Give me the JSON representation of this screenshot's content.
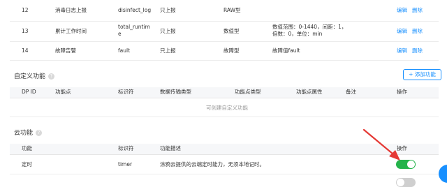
{
  "standard_rows": [
    {
      "id": "12",
      "name": "消毒日志上报",
      "identifier": "disinfect_log",
      "transfer": "只上报",
      "type": "RAW型",
      "attr": "",
      "edit": "编辑",
      "del": "删除"
    },
    {
      "id": "13",
      "name": "累计工作时间",
      "identifier_l1": "total_runtim",
      "identifier_l2": "e",
      "transfer": "只上报",
      "type": "数值型",
      "attr_l1": "数值范围：0-1440，间距：1，",
      "attr_l2": "倍数：0，单位：min",
      "edit": "编辑",
      "del": "删除"
    },
    {
      "id": "14",
      "name": "故障告警",
      "identifier": "fault",
      "transfer": "只上报",
      "type": "故障型",
      "attr": "故障值fault",
      "edit": "编辑",
      "del": "删除"
    }
  ],
  "custom": {
    "title": "自定义功能",
    "add_button": "+ 添加功能",
    "headers": [
      "DP ID",
      "功能点",
      "标识符",
      "数据传输类型",
      "功能点类型",
      "功能点属性",
      "备注",
      "操作"
    ],
    "empty_text": "可创建自定义功能"
  },
  "cloud": {
    "title": "云功能",
    "headers": [
      "功能",
      "标识符",
      "功能描述",
      "操作"
    ],
    "rows": [
      {
        "name": "定时",
        "identifier": "timer",
        "desc": "涂鸦云提供的云端定时能力，无须本地记时。",
        "enabled": true
      }
    ]
  },
  "colors": {
    "accent": "#1890ff",
    "toggle_on": "#24b34b",
    "toggle_off": "#cfcfcf",
    "arrow": "#e53935"
  },
  "icons": {
    "help": "question-circle-icon",
    "fab": "chat-bubble-icon"
  }
}
